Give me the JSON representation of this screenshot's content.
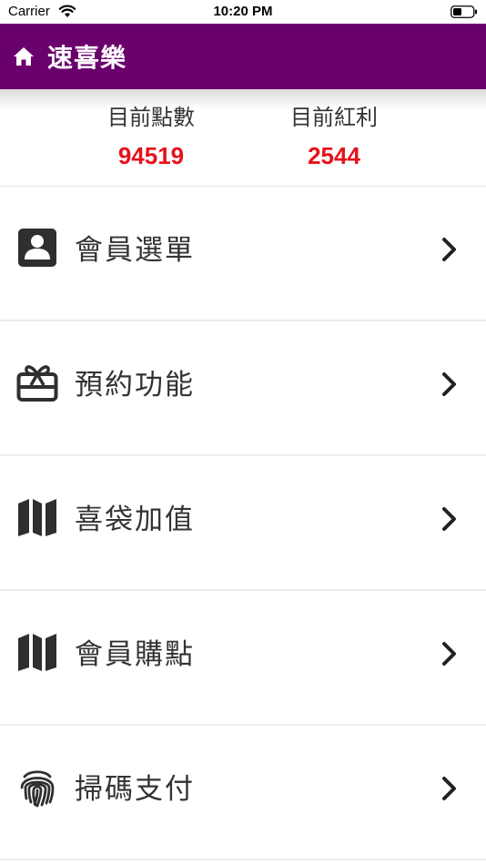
{
  "status_bar": {
    "carrier": "Carrier",
    "time": "10:20 PM"
  },
  "nav": {
    "title": "速喜樂",
    "bar_color": "#6a006b",
    "home_icon": "home-icon"
  },
  "stats": {
    "points_label": "目前點數",
    "points_value": "94519",
    "bonus_label": "目前紅利",
    "bonus_value": "2544",
    "value_color": "#e4131b"
  },
  "menu": {
    "items": [
      {
        "label": "會員選單",
        "icon": "member-card-icon"
      },
      {
        "label": "預約功能",
        "icon": "gift-card-icon"
      },
      {
        "label": "喜袋加值",
        "icon": "map-icon"
      },
      {
        "label": "會員購點",
        "icon": "map-icon"
      },
      {
        "label": "掃碼支付",
        "icon": "fingerprint-icon"
      }
    ]
  }
}
